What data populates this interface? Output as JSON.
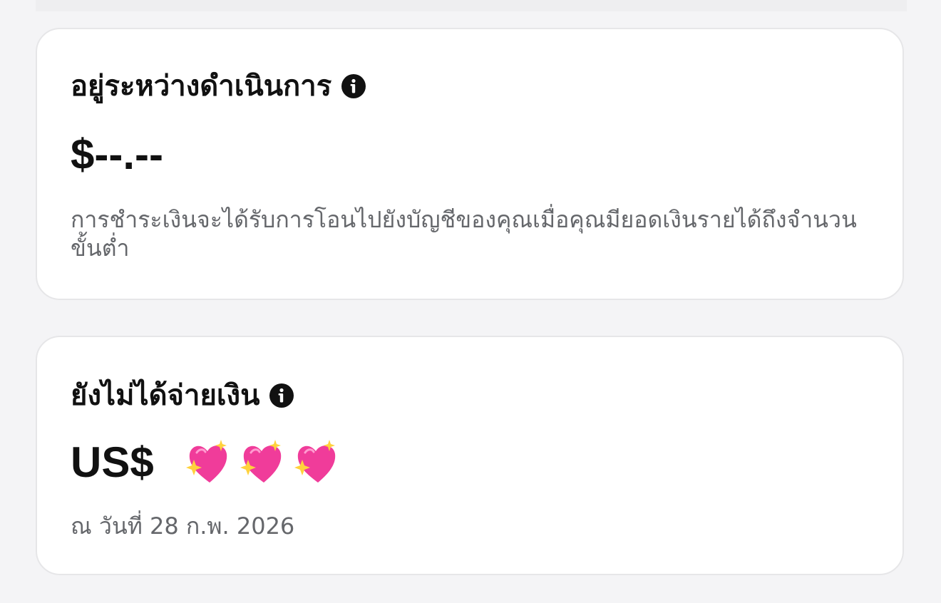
{
  "pending_card": {
    "title": "อยู่ระหว่างดำเนินการ",
    "info_icon": "info-circle-icon",
    "amount": "$--.--",
    "description": "การชำระเงินจะได้รับการโอนไปยังบัญชีของคุณเมื่อคุณมียอดเงินรายได้ถึงจำนวนขั้นต่ำ"
  },
  "unpaid_card": {
    "title": "ยังไม่ได้จ่ายเงิน",
    "info_icon": "info-circle-icon",
    "amount": "US$",
    "emojis": [
      "sparkling-heart",
      "sparkling-heart",
      "sparkling-heart"
    ],
    "date_text": "ณ วันที่ 28 ก.พ. 2026"
  },
  "colors": {
    "background": "#f4f4f6",
    "card": "#ffffff",
    "text_primary": "#111111",
    "text_secondary": "#65676b",
    "heart_pink": "#f03c9a",
    "sparkle_yellow": "#ffd23c"
  }
}
